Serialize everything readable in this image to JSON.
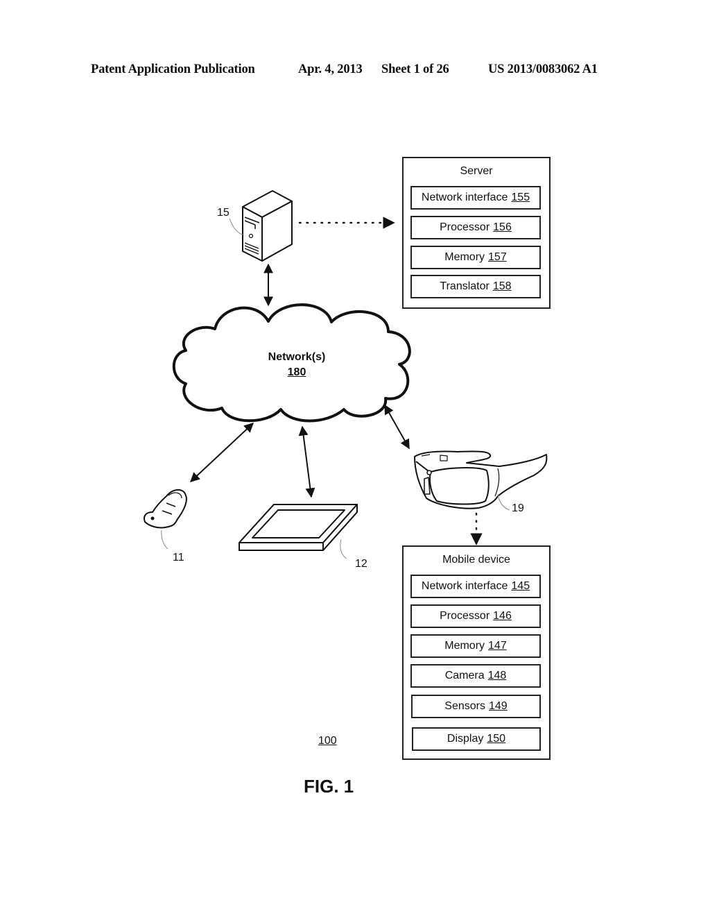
{
  "header": {
    "publication": "Patent Application Publication",
    "date": "Apr. 4, 2013",
    "sheet": "Sheet 1 of 26",
    "number": "US 2013/0083062 A1"
  },
  "server": {
    "title": "Server",
    "components": [
      {
        "label": "Network interface",
        "ref": "155"
      },
      {
        "label": "Processor",
        "ref": "156"
      },
      {
        "label": "Memory",
        "ref": "157"
      },
      {
        "label": "Translator",
        "ref": "158"
      }
    ]
  },
  "mobile_device": {
    "title": "Mobile device",
    "components": [
      {
        "label": "Network interface",
        "ref": "145"
      },
      {
        "label": "Processor",
        "ref": "146"
      },
      {
        "label": "Memory",
        "ref": "147"
      },
      {
        "label": "Camera",
        "ref": "148"
      },
      {
        "label": "Sensors",
        "ref": "149"
      },
      {
        "label": "Display",
        "ref": "150"
      }
    ]
  },
  "network": {
    "label": "Network(s)",
    "ref": "180"
  },
  "devices": {
    "server_tower_ref": "15",
    "phone_ref": "11",
    "tablet_ref": "12",
    "glasses_ref": "19"
  },
  "system_ref": "100",
  "figure_label": "FIG. 1"
}
